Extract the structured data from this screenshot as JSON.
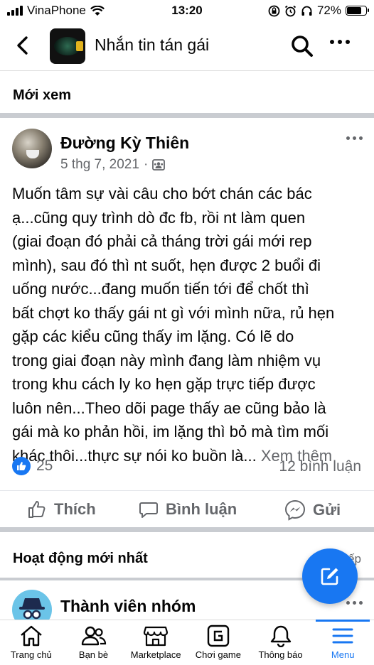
{
  "status_bar": {
    "carrier": "VinaPhone",
    "time": "13:20",
    "battery": "72%",
    "battery_level": 0.72
  },
  "header": {
    "title": "Nhắn tin tán gái"
  },
  "recent_section": {
    "label": "Mới xem"
  },
  "post": {
    "author": "Đường Kỳ Thiên",
    "date": "5 thg 7, 2021",
    "separator": "·",
    "body_lines": [
      "Muốn tâm sự vài câu cho bớt chán các bác",
      "ạ...cũng quy trình dò đc fb, rồi nt làm quen",
      "(giai đoạn đó phải cả tháng trời gái mới rep",
      "mình), sau đó thì nt suốt, hẹn được 2 buổi đi",
      "uống nước...đang muốn tiến tới để chốt thì",
      "bất chợt ko thấy gái nt gì với mình nữa, rủ hẹn",
      "gặp các kiểu cũng thấy im lặng. Có lẽ do",
      "trong giai đoạn này mình đang làm nhiệm vụ",
      "trong khu cách ly ko hẹn gặp trực tiếp được",
      "luôn nên...Theo dõi page thấy ae cũng bảo là",
      "gái mà ko phản hồi, im lặng thì bỏ mà tìm mối"
    ],
    "last_line": "khác thôi...thực sự nói ko buồn là...",
    "see_more": "Xem thêm",
    "like_count": "25",
    "comment_count": "12 bình luận",
    "actions": {
      "like": "Thích",
      "comment": "Bình luận",
      "share": "Gửi"
    }
  },
  "activity_section": {
    "label": "Hoạt động mới nhất",
    "right_text": "ếp"
  },
  "member_row": {
    "label": "Thành viên nhóm"
  },
  "bottom_nav": {
    "home": "Trang chủ",
    "friends": "Bạn bè",
    "marketplace": "Marketplace",
    "gaming": "Chơi game",
    "notifications": "Thông báo",
    "menu": "Menu"
  },
  "colors": {
    "accent": "#1877f2",
    "secondary_text": "#65676b",
    "divider": "#c9ccd1"
  }
}
